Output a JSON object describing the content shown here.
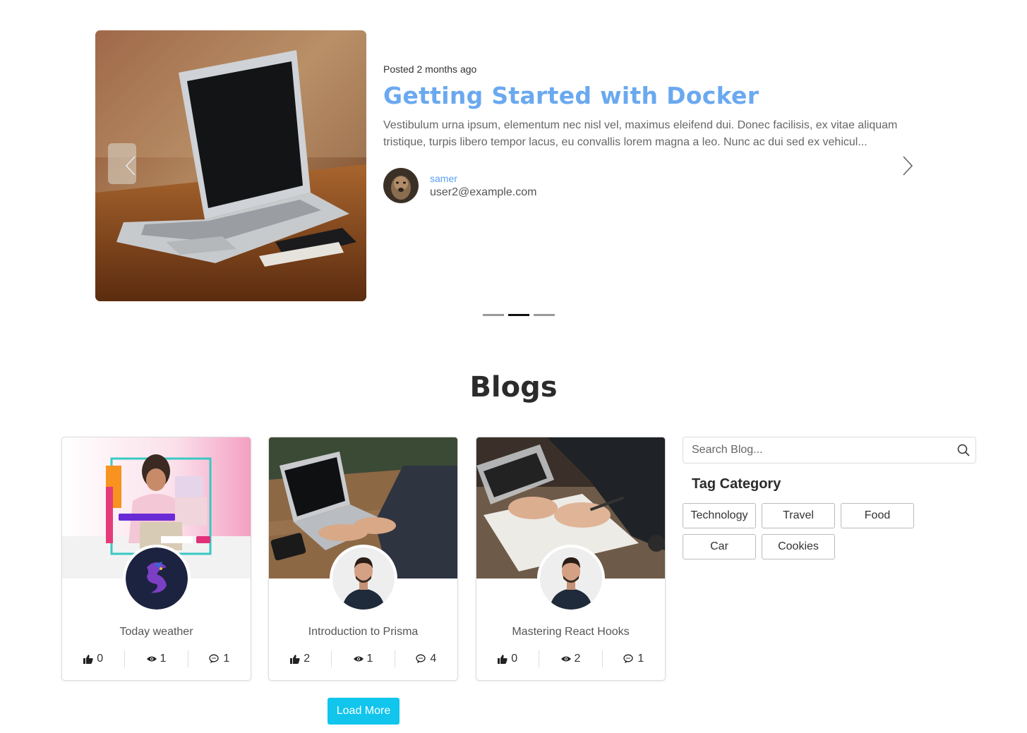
{
  "carousel": {
    "posted": "Posted 2 months ago",
    "title": "Getting Started with Docker",
    "excerpt": "Vestibulum urna ipsum, elementum nec nisl vel, maximus eleifend dui. Donec facilisis, ex vitae aliquam tristique, turpis libero tempor lacus, eu convallis lorem magna a leo. Nunc ac dui sed ex vehicul...",
    "author": {
      "name": "samer",
      "email": "user2@example.com"
    },
    "icons": {
      "prev": "chevron-left-icon",
      "next": "chevron-right-icon"
    },
    "slides": 3,
    "active_slide": 2
  },
  "blogs": {
    "heading": "Blogs",
    "cards": [
      {
        "title": "Today weather",
        "likes": "0",
        "views": "1",
        "comments": "1"
      },
      {
        "title": "Introduction to Prisma",
        "likes": "2",
        "views": "1",
        "comments": "4"
      },
      {
        "title": "Mastering React Hooks",
        "likes": "0",
        "views": "2",
        "comments": "1"
      }
    ],
    "load_more": "Load More",
    "icons": {
      "likes": "thumbs-up-icon",
      "views": "eye-icon",
      "comments": "comment-icon"
    }
  },
  "sidebar": {
    "search_placeholder": "Search Blog...",
    "tag_heading": "Tag Category",
    "tags": [
      "Technology",
      "Travel",
      "Food",
      "Car",
      "Cookies"
    ]
  },
  "colors": {
    "title_blue": "#6aa9f0",
    "author_blue": "#5b9ef5",
    "load_more_bg": "#11c5ec"
  }
}
